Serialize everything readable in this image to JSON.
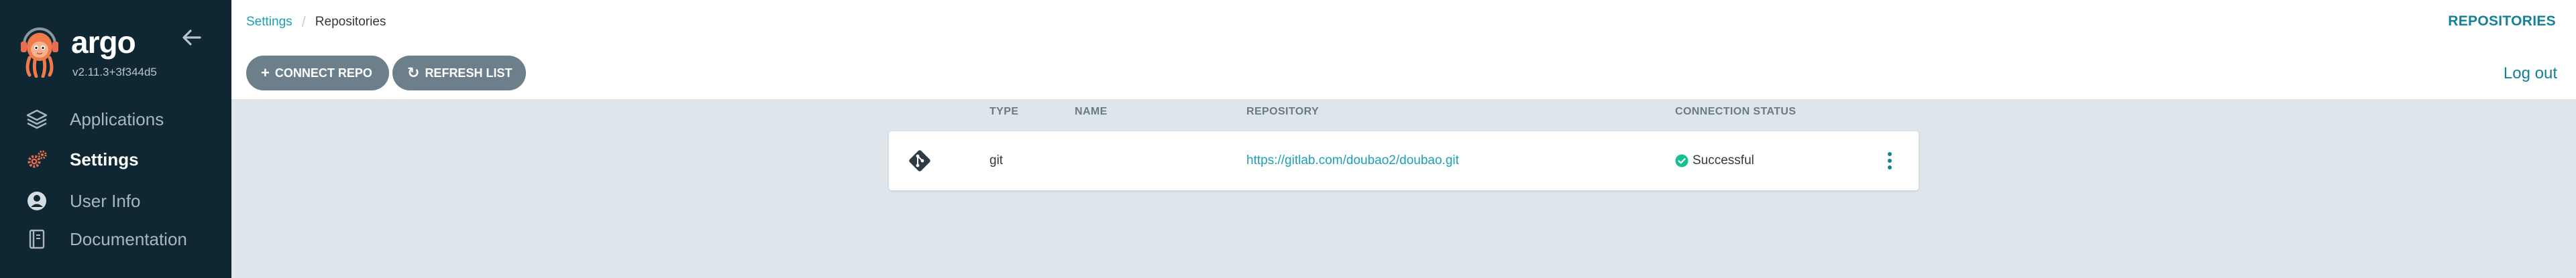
{
  "app": {
    "name": "argo",
    "version": "v2.11.3+3f344d5"
  },
  "sidebar": {
    "items": [
      {
        "label": "Applications",
        "icon": "layers-icon",
        "active": false
      },
      {
        "label": "Settings",
        "icon": "gears-icon",
        "active": true
      },
      {
        "label": "User Info",
        "icon": "user-circle-icon",
        "active": false
      },
      {
        "label": "Documentation",
        "icon": "book-icon",
        "active": false
      }
    ]
  },
  "breadcrumb": {
    "parent": "Settings",
    "separator": "/",
    "current": "Repositories"
  },
  "header": {
    "title": "REPOSITORIES",
    "logout_label": "Log out"
  },
  "toolbar": {
    "connect_label": "CONNECT REPO",
    "connect_icon": "plus-icon",
    "refresh_label": "REFRESH LIST",
    "refresh_icon": "refresh-icon"
  },
  "table": {
    "columns": [
      "TYPE",
      "NAME",
      "REPOSITORY",
      "CONNECTION STATUS"
    ],
    "rows": [
      {
        "icon": "git-icon",
        "type": "git",
        "name": "",
        "repository": "https://gitlab.com/doubao2/doubao.git",
        "status": "Successful",
        "status_icon": "check-circle-icon"
      }
    ]
  },
  "colors": {
    "sidebar_bg": "#0f2733",
    "accent": "#138297",
    "link": "#1a9fb6",
    "button_bg": "#6d7f8b",
    "content_bg": "#dee6eb",
    "success": "#18be94",
    "settings_icon": "#e96d4c"
  }
}
